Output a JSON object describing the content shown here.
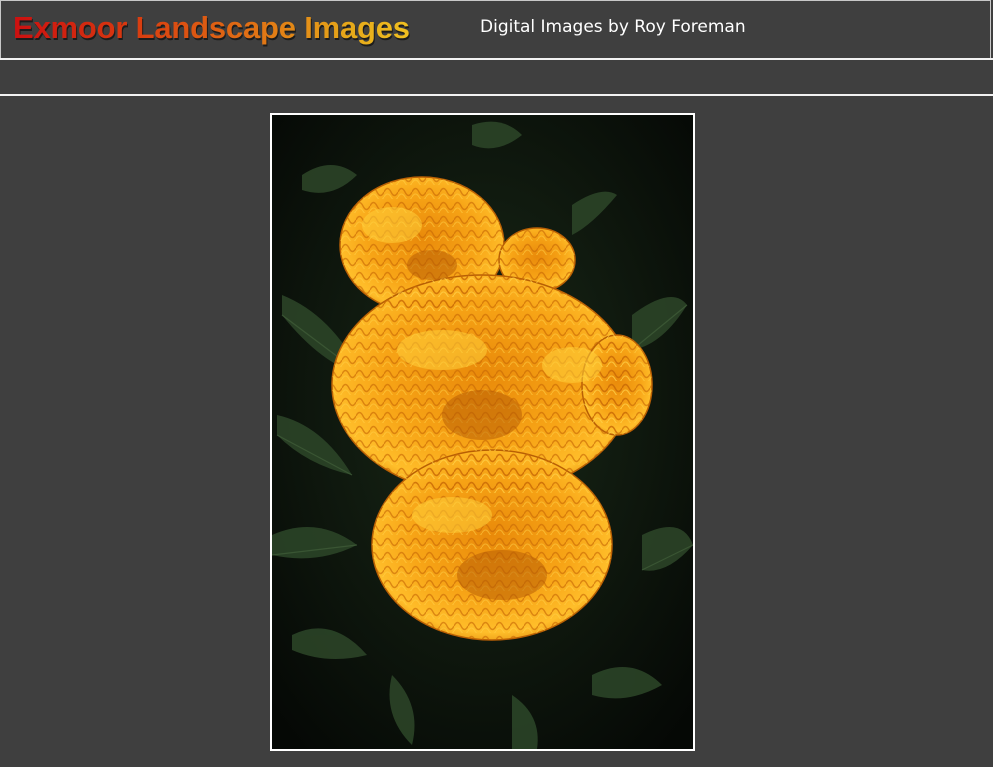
{
  "header": {
    "site_title": "Exmoor Landscape Images",
    "subtitle": "Digital Images by Roy Foreman"
  },
  "photo": {
    "subject": "marigold-flower-image",
    "colors": {
      "background": "#0c140c",
      "leaf": "#2e4a2a",
      "petal_main": "#f59a10",
      "petal_light": "#ffc030",
      "petal_dark": "#c96a05"
    }
  },
  "theme": {
    "page_bg": "#3f3f3f",
    "rule_color": "#f2f2f2",
    "title_gradient": [
      "#cc1010",
      "#f0c020"
    ]
  }
}
